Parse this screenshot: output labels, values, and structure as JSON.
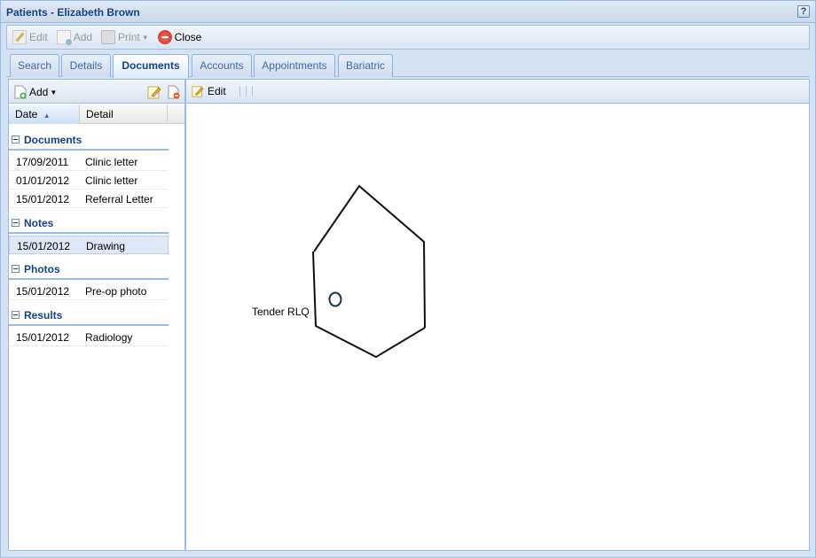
{
  "window": {
    "title": "Patients - Elizabeth Brown",
    "help_label": "?"
  },
  "toolbar": {
    "edit_label": "Edit",
    "add_label": "Add",
    "print_label": "Print",
    "close_label": "Close"
  },
  "tabs": [
    {
      "label": "Search"
    },
    {
      "label": "Details"
    },
    {
      "label": "Documents",
      "active": true
    },
    {
      "label": "Accounts"
    },
    {
      "label": "Appointments"
    },
    {
      "label": "Bariatric"
    }
  ],
  "left_panel": {
    "add_label": "Add",
    "columns": {
      "date": "Date",
      "detail": "Detail"
    },
    "groups": [
      {
        "name": "Documents",
        "rows": [
          {
            "date": "17/09/2011",
            "detail": "Clinic letter"
          },
          {
            "date": "01/01/2012",
            "detail": "Clinic letter"
          },
          {
            "date": "15/01/2012",
            "detail": "Referral Letter"
          }
        ]
      },
      {
        "name": "Notes",
        "rows": [
          {
            "date": "15/01/2012",
            "detail": "Drawing",
            "selected": true
          }
        ]
      },
      {
        "name": "Photos",
        "rows": [
          {
            "date": "15/01/2012",
            "detail": "Pre-op photo"
          }
        ]
      },
      {
        "name": "Results",
        "rows": [
          {
            "date": "15/01/2012",
            "detail": "Radiology"
          }
        ]
      }
    ]
  },
  "right_panel": {
    "edit_label": "Edit",
    "drawing_annotation": "Tender RLQ"
  }
}
